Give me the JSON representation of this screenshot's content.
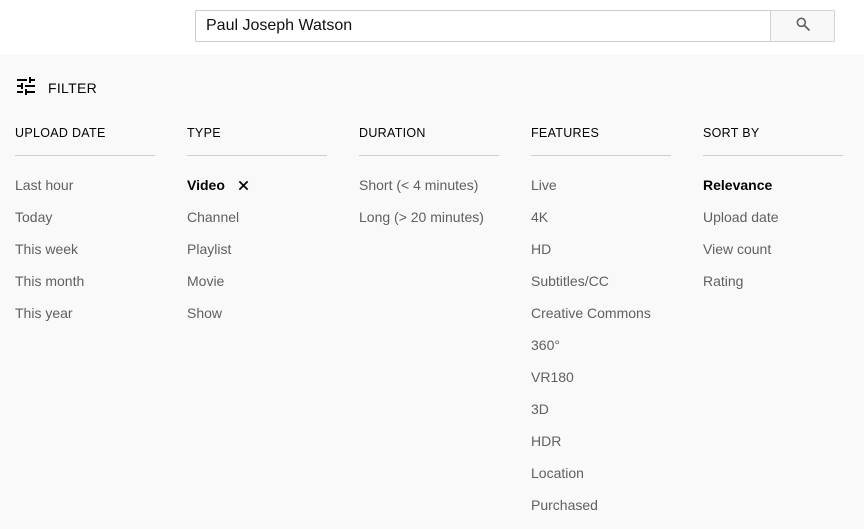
{
  "search": {
    "query": "Paul Joseph Watson"
  },
  "filter_toggle": {
    "label": "FILTER",
    "icon": "tune-sliders-icon"
  },
  "filters": [
    {
      "header": "UPLOAD DATE",
      "options": [
        {
          "label": "Last hour",
          "selected": false
        },
        {
          "label": "Today",
          "selected": false
        },
        {
          "label": "This week",
          "selected": false
        },
        {
          "label": "This month",
          "selected": false
        },
        {
          "label": "This year",
          "selected": false
        }
      ]
    },
    {
      "header": "TYPE",
      "options": [
        {
          "label": "Video",
          "selected": true
        },
        {
          "label": "Channel",
          "selected": false
        },
        {
          "label": "Playlist",
          "selected": false
        },
        {
          "label": "Movie",
          "selected": false
        },
        {
          "label": "Show",
          "selected": false
        }
      ]
    },
    {
      "header": "DURATION",
      "options": [
        {
          "label": "Short (< 4 minutes)",
          "selected": false
        },
        {
          "label": "Long (> 20 minutes)",
          "selected": false
        }
      ]
    },
    {
      "header": "FEATURES",
      "options": [
        {
          "label": "Live",
          "selected": false
        },
        {
          "label": "4K",
          "selected": false
        },
        {
          "label": "HD",
          "selected": false
        },
        {
          "label": "Subtitles/CC",
          "selected": false
        },
        {
          "label": "Creative Commons",
          "selected": false
        },
        {
          "label": "360°",
          "selected": false
        },
        {
          "label": "VR180",
          "selected": false
        },
        {
          "label": "3D",
          "selected": false
        },
        {
          "label": "HDR",
          "selected": false
        },
        {
          "label": "Location",
          "selected": false
        },
        {
          "label": "Purchased",
          "selected": false
        }
      ]
    },
    {
      "header": "SORT BY",
      "options": [
        {
          "label": "Relevance",
          "selected": true
        },
        {
          "label": "Upload date",
          "selected": false
        },
        {
          "label": "View count",
          "selected": false
        },
        {
          "label": "Rating",
          "selected": false
        }
      ]
    }
  ],
  "colors": {
    "page_background": "#f9f9f9",
    "header_background": "#ffffff",
    "selected_text": "#030303",
    "option_text": "#606060"
  }
}
